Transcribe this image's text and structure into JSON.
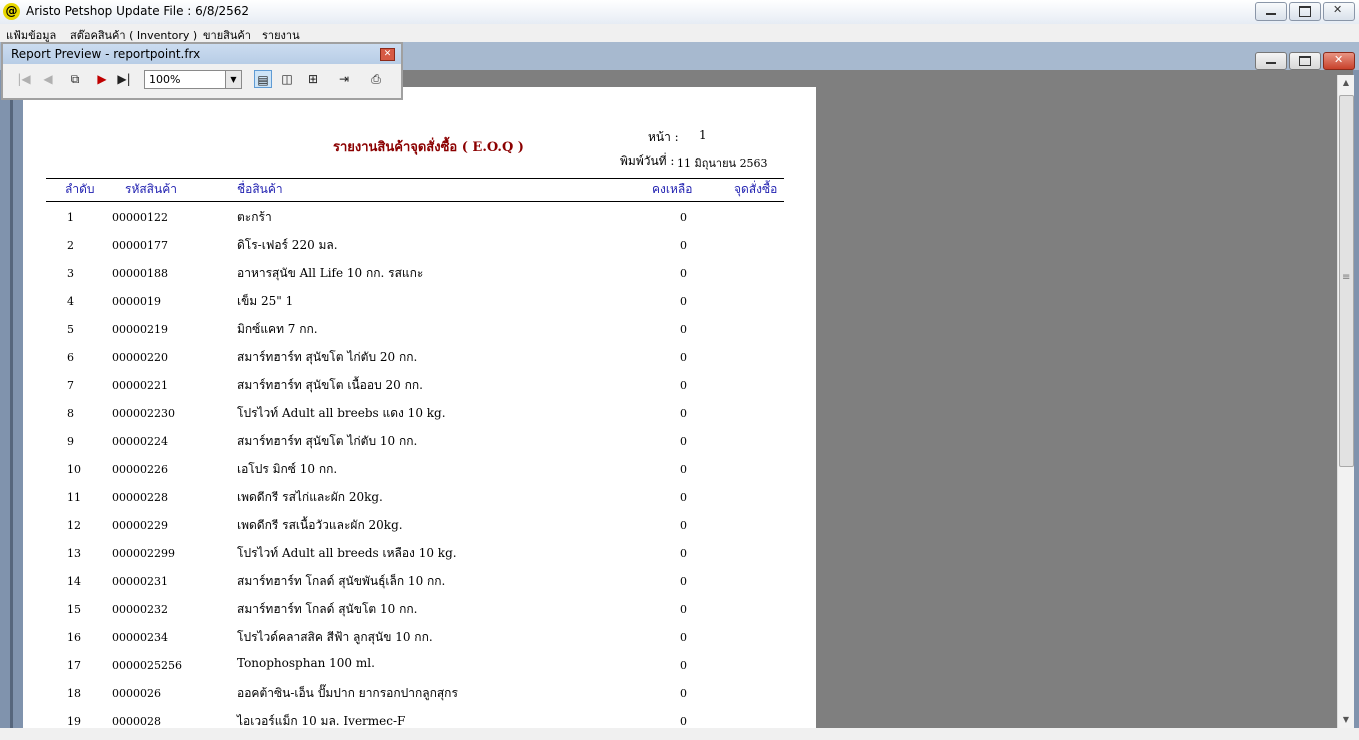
{
  "window": {
    "icon_glyph": "@",
    "title": "Aristo Petshop  Update File : 6/8/2562"
  },
  "menu": [
    "แฟ้มข้อมูล",
    "สต๊อคสินค้า ( Inventory )",
    "ขายสินค้า",
    "รายงาน"
  ],
  "preview_toolbar": {
    "title": "Report Preview - reportpoint.frx",
    "zoom": "100%",
    "icons": [
      "first-page-icon",
      "prev-page-icon",
      "goto-page-icon",
      "next-page-icon",
      "last-page-icon",
      "one-page-icon",
      "two-page-icon",
      "multi-page-icon",
      "close-preview-icon",
      "print-icon"
    ]
  },
  "report": {
    "title": "รายงานสินค้าจุดสั่งซื้อ ( E.O.Q )",
    "page_label": "หน้า :",
    "page_number": "1",
    "printed_label": "พิมพ์วันที่ :",
    "printed_date": "11 มิถุนายน 2563",
    "columns": [
      "ลำดับ",
      "รหัสสินค้า",
      "ชื่อสินค้า",
      "คงเหลือ",
      "จุดสั่งซื้อ"
    ],
    "rows": [
      {
        "no": "1",
        "code": "00000122",
        "name": "ตะกร้า",
        "qty": "0"
      },
      {
        "no": "2",
        "code": "00000177",
        "name": "ดิโร-เฟอร์ 220 มล.",
        "qty": "0"
      },
      {
        "no": "3",
        "code": "00000188",
        "name": "อาหารสุนัข All Life 10 กก. รสแกะ",
        "qty": "0"
      },
      {
        "no": "4",
        "code": "0000019",
        "name": "เข็ม 25\" 1",
        "qty": "0"
      },
      {
        "no": "5",
        "code": "00000219",
        "name": "มิกซ์แคท 7 กก.",
        "qty": "0"
      },
      {
        "no": "6",
        "code": "00000220",
        "name": "สมาร์ทฮาร์ท สุนัขโต ไก่ตับ 20 กก.",
        "qty": "0"
      },
      {
        "no": "7",
        "code": "00000221",
        "name": "สมาร์ทฮาร์ท สุนัขโต เนื้ออบ 20 กก.",
        "qty": "0"
      },
      {
        "no": "8",
        "code": "000002230",
        "name": "โปรไวท์ Adult all breebs แดง 10 kg.",
        "qty": "0"
      },
      {
        "no": "9",
        "code": "00000224",
        "name": "สมาร์ทฮาร์ท สุนัขโต ไก่ตับ 10 กก.",
        "qty": "0"
      },
      {
        "no": "10",
        "code": "00000226",
        "name": "เอโปร มิกซ์ 10 กก.",
        "qty": "0"
      },
      {
        "no": "11",
        "code": "00000228",
        "name": "เพดดีกรี รสไก่และผัก 20kg.",
        "qty": "0"
      },
      {
        "no": "12",
        "code": "00000229",
        "name": "เพดดีกรี รสเนื้อวัวและผัก 20kg.",
        "qty": "0"
      },
      {
        "no": "13",
        "code": "000002299",
        "name": "โปรไวท์ Adult all breeds เหลือง 10 kg.",
        "qty": "0"
      },
      {
        "no": "14",
        "code": "00000231",
        "name": "สมาร์ทฮาร์ท โกลด์ สุนัขพันธุ์เล็ก 10 กก.",
        "qty": "0"
      },
      {
        "no": "15",
        "code": "00000232",
        "name": "สมาร์ทฮาร์ท โกลด์ สุนัขโต 10 กก.",
        "qty": "0"
      },
      {
        "no": "16",
        "code": "00000234",
        "name": "โปรไวด์คลาสสิค สีฟ้า ลูกสุนัข 10 กก.",
        "qty": "0"
      },
      {
        "no": "17",
        "code": "0000025256",
        "name": "Tonophosphan 100 ml.",
        "qty": "0"
      },
      {
        "no": "18",
        "code": "0000026",
        "name": "ออคต้าซิน-เอ็น ปั๊มปาก ยากรอกปากลูกสุกร",
        "qty": "0"
      },
      {
        "no": "19",
        "code": "0000028",
        "name": "ไอเวอร์แม็ก 10 มล. Ivermec-F",
        "qty": "0"
      }
    ]
  }
}
